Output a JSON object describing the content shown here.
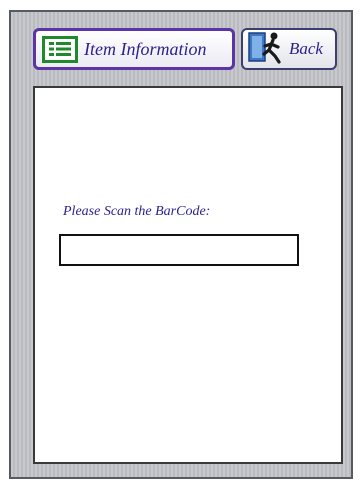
{
  "tabs": {
    "item_information": {
      "label": "Item Information",
      "icon": "list-icon"
    },
    "back": {
      "label": "Back",
      "icon": "exit-door-icon"
    }
  },
  "form": {
    "scan_label": "Please Scan the BarCode:",
    "barcode_value": ""
  },
  "colors": {
    "label_text": "#2a1f8f",
    "active_tab_border": "#5b34a6",
    "list_icon_green": "#1e8a2c"
  }
}
